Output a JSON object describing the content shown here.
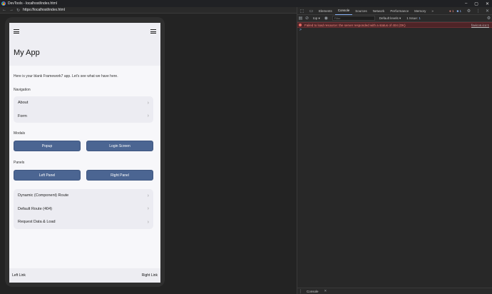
{
  "window": {
    "title": "DevTools - localhost/index.html"
  },
  "browser": {
    "url": "https://localhost/index.html"
  },
  "app": {
    "title": "My App",
    "intro": "Here is your blank Framework7 app. Let's see what we have here.",
    "navigation_label": "Navigation",
    "nav_items": [
      {
        "label": "About"
      },
      {
        "label": "Form"
      }
    ],
    "modals_label": "Modals",
    "popup_label": "Popup",
    "login_label": "Login Screen",
    "panels_label": "Panels",
    "left_panel_label": "Left Panel",
    "right_panel_label": "Right Panel",
    "route_items": [
      {
        "label": "Dynamic (Component) Route"
      },
      {
        "label": "Default Route (404)"
      },
      {
        "label": "Request Data & Load"
      }
    ],
    "toolbar": {
      "left_link": "Left Link",
      "right_link": "Right Link"
    }
  },
  "devtools": {
    "tabs": [
      "Elements",
      "Console",
      "Sources",
      "Network",
      "Performance",
      "Memory"
    ],
    "active_tab": "Console",
    "more_tabs": "»",
    "error_count": "1",
    "info_count": "1",
    "context": "top ▾",
    "filter_placeholder": "Filter",
    "levels": "Default levels ▾",
    "issues": "1 Issue: ",
    "issues_count": "1",
    "console_error": "Failed to load resource: the server responded with a status of 404 (OK)",
    "console_error_source": "favicon.ico:1",
    "prompt": ">",
    "drawer_tab": "Console"
  }
}
